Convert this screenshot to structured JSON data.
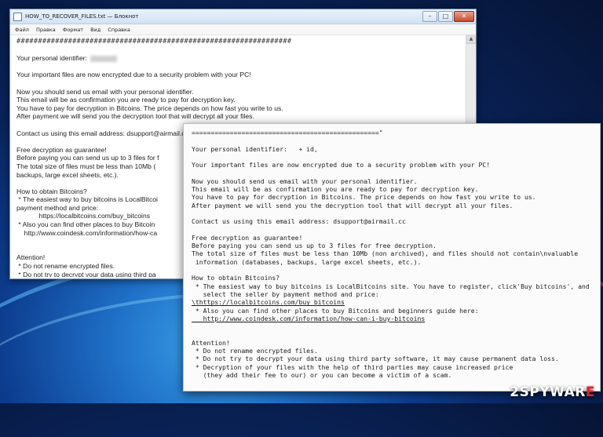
{
  "notepad": {
    "title": "HOW_TO_RECOVER_FILES.txt — Блокнот",
    "menu": [
      "Файл",
      "Правка",
      "Формат",
      "Вид",
      "Справка"
    ],
    "hashes": "################################################################",
    "lines": [
      "",
      "Your personal identifier:",
      "",
      "Your important files are now encrypted due to a security problem with your PC!",
      "",
      "Now you should send us email with your personal identifier.",
      "This email will be as confirmation you are ready to pay for decryption key.",
      "You have to pay for decryption in Bitcoins. The price depends on how fast you write to us.",
      "After payment we will send you the decryption tool that will decrypt all your files.",
      "",
      "Contact us using this email address: dsupport@airmail.cc",
      "",
      "Free decryption as guarantee!",
      "Before paying you can send us up to 3 files for f",
      "The total size of files must be less than 10Mb (",
      "backups, large excel sheets, etc.).",
      "",
      "How to obtain Bitcoins?",
      " * The easiest way to buy bitcoins is LocalBitcoi",
      "payment method and price:",
      "            https://localbitcoins.com/buy_bitcoins",
      " * Also you can find other places to buy Bitcoin",
      "    http://www.coindesk.com/information/how-ca",
      "",
      "",
      "Attention!",
      " * Do not rename encrypted files.",
      " * Do not try to decrypt your data using third pa",
      " * Decryption of your files with the help of third",
      "    (they add their fee to our) or you can become"
    ]
  },
  "panel": {
    "lines": [
      "=================================================\"",
      "",
      "Your personal identifier:   + id,",
      "",
      "Your important files are now encrypted due to a security problem with your PC!",
      "",
      "Now you should send us email with your personal identifier.",
      "This email will be as confirmation you are ready to pay for decryption key.",
      "You have to pay for decryption in Bitcoins. The price depends on how fast you write to us.",
      "After payment we will send you the decryption tool that will decrypt all your files.",
      "",
      "Contact us using this email address: dsupport@airmail.cc",
      "",
      "Free decryption as guarantee!",
      "Before paying you can send us up to 3 files for free decryption.",
      "The total size of files must be less than 10Mb (non archived), and files should not contain\\nvaluable",
      " information (databases, backups, large excel sheets, etc.).",
      "",
      "How to obtain Bitcoins?",
      " * The easiest way to buy bitcoins is LocalBitcoins site. You have to register, click'Buy bitcoins', and",
      "   select the seller by payment method and price:",
      "\\thttps://localbitcoins.com/buy_bitcoins",
      " * Also you can find other places to buy Bitcoins and beginners guide here:",
      "   http://www.coindesk.com/information/how-can-i-buy-bitcoins",
      "",
      "",
      "Attention!",
      " * Do not rename encrypted files.",
      " * Do not try to decrypt your data using third party software, it may cause permanent data loss.",
      " * Decryption of your files with the help of third parties may cause increased price",
      "   (they add their fee to our) or you can become a victim of a scam."
    ]
  },
  "watermark": {
    "prefix": "2SPYWAR",
    "suffix": "E",
    "mark": ""
  }
}
